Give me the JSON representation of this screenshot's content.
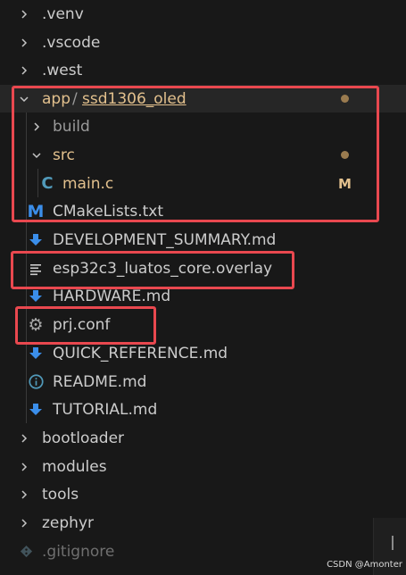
{
  "colors": {
    "background": "#181818",
    "folder_text": "#cccccc",
    "muted_text": "#9a9a9a",
    "modified_text": "#e2c08d",
    "modified_dot": "#9a7b4f",
    "md_icon_blue": "#3b8eea",
    "c_icon_blue": "#519aba",
    "highlight_border": "#e9484f"
  },
  "explorer": {
    "rows": [
      {
        "label": ".venv",
        "icon": "chevron-right-icon"
      },
      {
        "label": ".vscode",
        "icon": "chevron-right-icon"
      },
      {
        "label": ".west",
        "icon": "chevron-right-icon"
      },
      {
        "label_prefix": "app",
        "separator": "/",
        "label": "ssd1306_oled",
        "icon": "chevron-down-icon",
        "status": "modified-dot"
      },
      {
        "label": "build",
        "icon": "chevron-right-icon"
      },
      {
        "label": "src",
        "icon": "chevron-down-icon",
        "status": "modified-dot"
      },
      {
        "label": "main.c",
        "icon": "c-file-icon",
        "status_letter": "M"
      },
      {
        "label": "CMakeLists.txt",
        "icon": "cmake-file-icon"
      },
      {
        "label": "DEVELOPMENT_SUMMARY.md",
        "icon": "download-arrow-icon"
      },
      {
        "label": "esp32c3_luatos_core.overlay",
        "icon": "lines-file-icon"
      },
      {
        "label": "HARDWARE.md",
        "icon": "download-arrow-icon"
      },
      {
        "label": "prj.conf",
        "icon": "gear-icon"
      },
      {
        "label": "QUICK_REFERENCE.md",
        "icon": "download-arrow-icon"
      },
      {
        "label": "README.md",
        "icon": "info-icon"
      },
      {
        "label": "TUTORIAL.md",
        "icon": "download-arrow-icon"
      },
      {
        "label": "bootloader",
        "icon": "chevron-right-icon"
      },
      {
        "label": "modules",
        "icon": "chevron-right-icon"
      },
      {
        "label": "tools",
        "icon": "chevron-right-icon"
      },
      {
        "label": "zephyr",
        "icon": "chevron-right-icon"
      },
      {
        "label": ".gitignore",
        "icon": "diamond-icon"
      }
    ]
  },
  "watermark": "CSDN @Amonter"
}
